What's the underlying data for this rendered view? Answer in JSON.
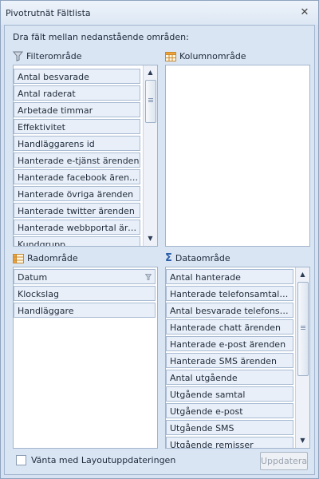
{
  "window": {
    "title": "Pivotrutnät Fältlista",
    "close_icon": "close-icon"
  },
  "instruction": "Dra fält mellan nedanstående områden:",
  "filter_area": {
    "label": "Filterområde",
    "icon": "filter-icon",
    "items": [
      "Antal besvarade",
      "Antal raderat",
      "Arbetade timmar",
      "Effektivitet",
      "Handläggarens id",
      "Hanterade e-tjänst ärenden",
      "Hanterade facebook ärenden",
      "Hanterade övriga ärenden",
      "Hanterade twitter ärenden",
      "Hanterade webbportal ären...",
      "Kundgrupp"
    ]
  },
  "column_area": {
    "label": "Kolumnområde",
    "icon": "column-area-icon",
    "items": []
  },
  "row_area": {
    "label": "Radområde",
    "icon": "row-area-icon",
    "items": [
      "Datum",
      "Klockslag",
      "Handläggare"
    ],
    "filter_indicator_icon": "filter-icon"
  },
  "data_area": {
    "label": "Dataområde",
    "icon": "sigma-icon",
    "items": [
      "Antal hanterade",
      "Hanterade telefonsamtals är...",
      "Antal besvarade telefonsamtal",
      "Hanterade chatt ärenden",
      "Hanterade e-post ärenden",
      "Hanterade SMS ärenden",
      "Antal utgående",
      "Utgående samtal",
      "Utgående e-post",
      "Utgående SMS",
      "Utgående remisser"
    ]
  },
  "footer": {
    "defer_label": "Vänta med Layoutuppdateringen",
    "update_label": "Uppdatera"
  }
}
